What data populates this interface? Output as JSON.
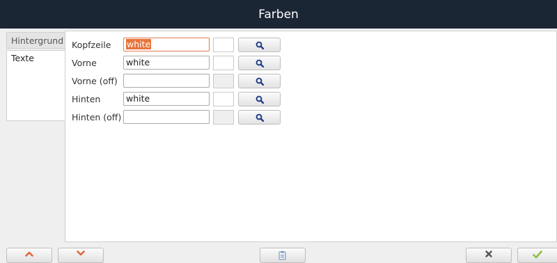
{
  "window": {
    "title": "Farben"
  },
  "tabs": [
    {
      "label": "Hintergrund",
      "active": false
    },
    {
      "label": "Texte",
      "active": true
    }
  ],
  "rows": [
    {
      "label": "Kopfzeile",
      "value": "white",
      "swatch": "white",
      "selected": true
    },
    {
      "label": "Vorne",
      "value": "white",
      "swatch": "white",
      "selected": false
    },
    {
      "label": "Vorne (off)",
      "value": "",
      "swatch": "none",
      "selected": false
    },
    {
      "label": "Hinten",
      "value": "white",
      "swatch": "white",
      "selected": false
    },
    {
      "label": "Hinten (off)",
      "value": "",
      "swatch": "none",
      "selected": false
    }
  ],
  "icons": {
    "picker": "magnifier-icon",
    "up": "chevron-up-icon",
    "down": "chevron-down-icon",
    "middle": "clipboard-icon",
    "cancel": "close-icon",
    "ok": "checkmark-icon"
  },
  "colors": {
    "titlebar": "#1b2635",
    "selection": "#e8743b",
    "chevron": "#e0663b",
    "ok": "#8cbf3f",
    "magnifier": "#1f3f8a"
  }
}
